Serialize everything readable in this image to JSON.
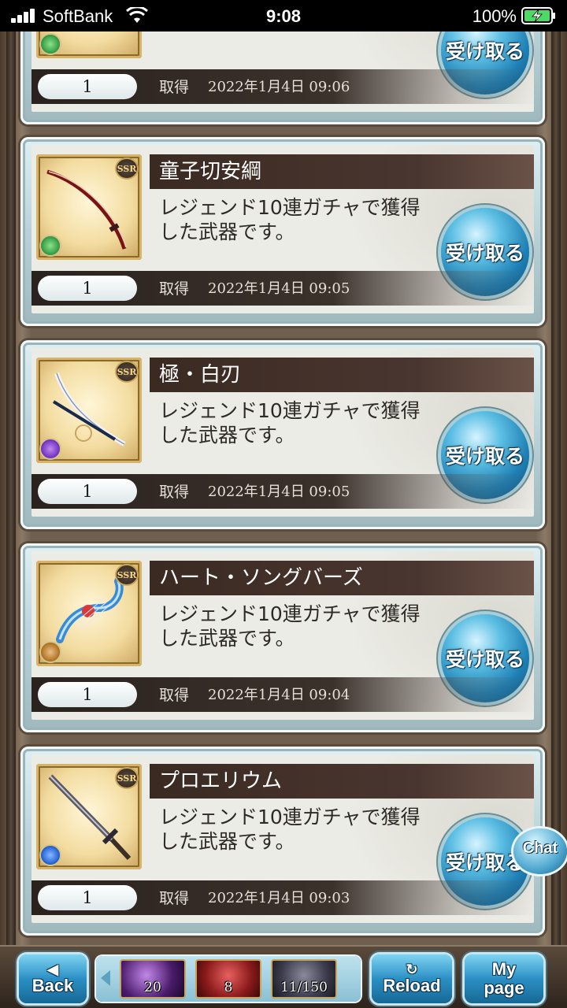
{
  "status_bar": {
    "carrier": "SoftBank",
    "time": "9:08",
    "battery_percent": "100%"
  },
  "receive_label": "受け取る",
  "acquired_label": "取得",
  "rarity_label": "SSR",
  "items": [
    {
      "name": "",
      "description": "",
      "quantity": "1",
      "acquired_date": "2022年1月4日 09:06",
      "element": "wind",
      "element_color": "#3aa24a"
    },
    {
      "name": "童子切安綱",
      "description": "レジェンド10連ガチャで獲得した武器です。",
      "quantity": "1",
      "acquired_date": "2022年1月4日 09:05",
      "element": "wind",
      "element_color": "#3aa24a",
      "icon": "katana-icon"
    },
    {
      "name": "極・白刃",
      "description": "レジェンド10連ガチャで獲得した武器です。",
      "quantity": "1",
      "acquired_date": "2022年1月4日 09:05",
      "element": "dark",
      "element_color": "#7a3ac8",
      "icon": "sword-icon"
    },
    {
      "name": "ハート・ソングバーズ",
      "description": "レジェンド10連ガチャで獲得した武器です。",
      "quantity": "1",
      "acquired_date": "2022年1月4日 09:04",
      "element": "earth",
      "element_color": "#b87a2a",
      "icon": "harp-icon"
    },
    {
      "name": "プロエリウム",
      "description": "レジェンド10連ガチャで獲得した武器です。",
      "quantity": "1",
      "acquired_date": "2022年1月4日 09:03",
      "element": "water",
      "element_color": "#2a6ad8",
      "icon": "longsword-icon"
    }
  ],
  "chat_label": "Chat",
  "footer": {
    "back_label": "Back",
    "reload_label": "Reload",
    "mypage_line1": "My",
    "mypage_line2": "page",
    "ap_value": "20",
    "bp_value": "8",
    "time_value": "11/150"
  }
}
